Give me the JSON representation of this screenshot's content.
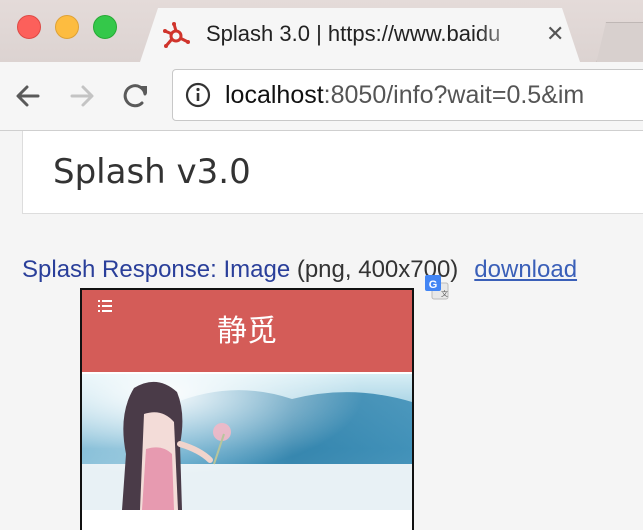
{
  "browser": {
    "tab_title": "Splash 3.0 | https://www.baidu",
    "tab_close": "✕",
    "url_host": "localhost",
    "url_rest": ":8050/info?wait=0.5&im"
  },
  "page": {
    "header_title": "Splash v3.0",
    "response_prefix": "Splash Response:",
    "response_kind": "Image",
    "response_meta": "(png, 400x700)",
    "download_label": "download"
  },
  "screenshot": {
    "title": "静觅"
  },
  "colors": {
    "accent_red": "#d45c58",
    "link_blue": "#3a5fb8"
  }
}
